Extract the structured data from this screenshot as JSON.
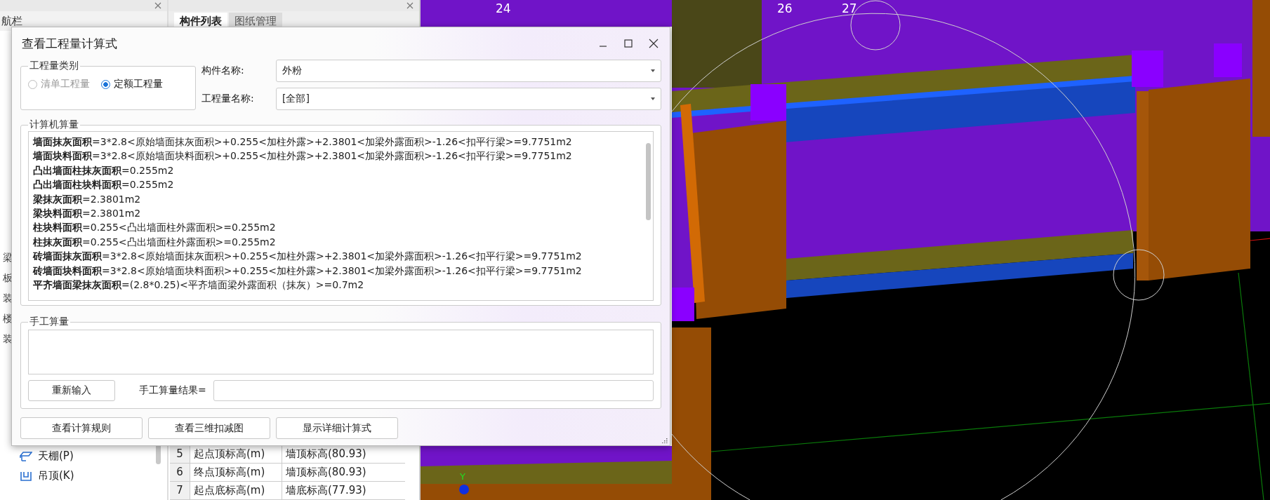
{
  "nav_panel": {
    "title": "航栏",
    "items": [
      {
        "label": "梁"
      },
      {
        "label": "板"
      },
      {
        "label": "装"
      },
      {
        "label": "楼"
      },
      {
        "label": "装"
      }
    ],
    "tree": [
      {
        "label": "天棚(P)",
        "kind": "ceiling"
      },
      {
        "label": "吊顶(K)",
        "kind": "suspended"
      }
    ]
  },
  "component_panel": {
    "tabs": [
      {
        "label": "构件列表",
        "selected": true
      },
      {
        "label": "图纸管理",
        "selected": false
      }
    ],
    "rows": [
      {
        "index": "5",
        "name": "起点顶标高(m)",
        "value": "墙顶标高(80.93)"
      },
      {
        "index": "6",
        "name": "终点顶标高(m)",
        "value": "墙顶标高(80.93)"
      },
      {
        "index": "7",
        "name": "起点底标高(m)",
        "value": "墙底标高(77.93)"
      }
    ]
  },
  "viewport": {
    "axis_labels": [
      "24",
      "26",
      "27"
    ],
    "gizmo_label": "Y"
  },
  "dialog": {
    "title": "查看工程量计算式",
    "quantity_type": {
      "legend": "工程量类别",
      "options": [
        {
          "label": "清单工程量",
          "selected": false,
          "disabled": true
        },
        {
          "label": "定额工程量",
          "selected": true,
          "disabled": false
        }
      ]
    },
    "fields": [
      {
        "label": "构件名称:",
        "value": "外粉"
      },
      {
        "label": "工程量名称:",
        "value": "[全部]"
      }
    ],
    "computer": {
      "legend": "计算机算量",
      "lines": [
        "**墙面抹灰面积**=3*2.8<原始墙面抹灰面积>+0.255<加柱外露>+2.3801<加梁外露面积>-1.26<扣平行梁>=9.7751m2",
        "**墙面块料面积**=3*2.8<原始墙面块料面积>+0.255<加柱外露>+2.3801<加梁外露面积>-1.26<扣平行梁>=9.7751m2",
        "**凸出墙面柱抹灰面积**=0.255m2",
        "**凸出墙面柱块料面积**=0.255m2",
        "**梁抹灰面积**=2.3801m2",
        "**梁块料面积**=2.3801m2",
        "**柱块料面积**=0.255<凸出墙面柱外露面积>=0.255m2",
        "**柱抹灰面积**=0.255<凸出墙面柱外露面积>=0.255m2",
        "**砖墙面抹灰面积**=3*2.8<原始墙面抹灰面积>+0.255<加柱外露>+2.3801<加梁外露面积>-1.26<扣平行梁>=9.7751m2",
        "**砖墙面块料面积**=3*2.8<原始墙面块料面积>+0.255<加柱外露>+2.3801<加梁外露面积>-1.26<扣平行梁>=9.7751m2",
        "**平齐墙面梁抹灰面积**=(2.8*0.25)<平齐墙面梁外露面积（抹灰）>=0.7m2"
      ]
    },
    "manual": {
      "legend": "手工算量",
      "reset_button": "重新输入",
      "result_label": "手工算量结果="
    },
    "buttons": [
      "查看计算规则",
      "查看三维扣减图",
      "显示详细计算式"
    ]
  }
}
